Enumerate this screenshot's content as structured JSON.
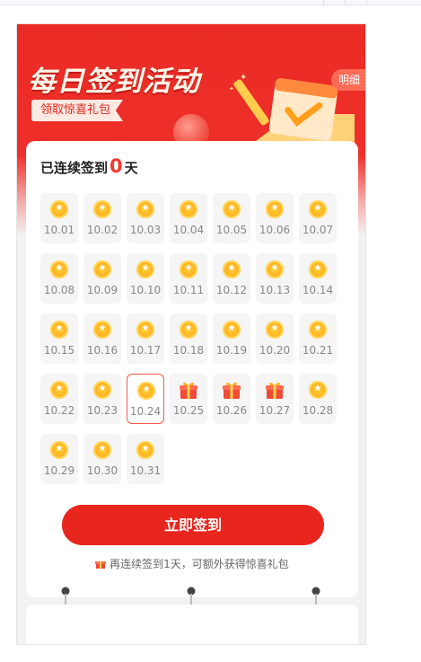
{
  "banner": {
    "title": "每日签到活动",
    "subtitle": "领取惊喜礼包",
    "detail_label": "明细"
  },
  "streak": {
    "prefix": "已连续签到",
    "count": "0",
    "suffix": "天"
  },
  "days": [
    {
      "label": "10.01",
      "icon": "coin-icon"
    },
    {
      "label": "10.02",
      "icon": "coin-icon"
    },
    {
      "label": "10.03",
      "icon": "coin-icon"
    },
    {
      "label": "10.04",
      "icon": "coin-icon"
    },
    {
      "label": "10.05",
      "icon": "coin-icon"
    },
    {
      "label": "10.06",
      "icon": "coin-icon"
    },
    {
      "label": "10.07",
      "icon": "coin-icon"
    },
    {
      "label": "10.08",
      "icon": "coin-icon"
    },
    {
      "label": "10.09",
      "icon": "coin-icon"
    },
    {
      "label": "10.10",
      "icon": "coin-icon"
    },
    {
      "label": "10.11",
      "icon": "coin-icon"
    },
    {
      "label": "10.12",
      "icon": "coin-icon"
    },
    {
      "label": "10.13",
      "icon": "coin-icon"
    },
    {
      "label": "10.14",
      "icon": "coin-icon"
    },
    {
      "label": "10.15",
      "icon": "coin-icon"
    },
    {
      "label": "10.16",
      "icon": "coin-icon"
    },
    {
      "label": "10.17",
      "icon": "coin-icon"
    },
    {
      "label": "10.18",
      "icon": "coin-icon"
    },
    {
      "label": "10.19",
      "icon": "coin-icon"
    },
    {
      "label": "10.20",
      "icon": "coin-icon"
    },
    {
      "label": "10.21",
      "icon": "coin-icon"
    },
    {
      "label": "10.22",
      "icon": "coin-icon"
    },
    {
      "label": "10.23",
      "icon": "coin-icon"
    },
    {
      "label": "10.24",
      "icon": "coin-icon",
      "today": true
    },
    {
      "label": "10.25",
      "icon": "gift-icon"
    },
    {
      "label": "10.26",
      "icon": "gift-icon"
    },
    {
      "label": "10.27",
      "icon": "gift-icon"
    },
    {
      "label": "10.28",
      "icon": "coin-icon"
    },
    {
      "label": "10.29",
      "icon": "coin-icon"
    },
    {
      "label": "10.30",
      "icon": "coin-icon"
    },
    {
      "label": "10.31",
      "icon": "coin-icon"
    }
  ],
  "sign_button_label": "立即签到",
  "tip_text": "再连续签到1天，可额外获得惊喜礼包",
  "colors": {
    "brand_red": "#e8261e",
    "coin_gold": "#ffb21f",
    "today_border": "#f05a4f"
  }
}
